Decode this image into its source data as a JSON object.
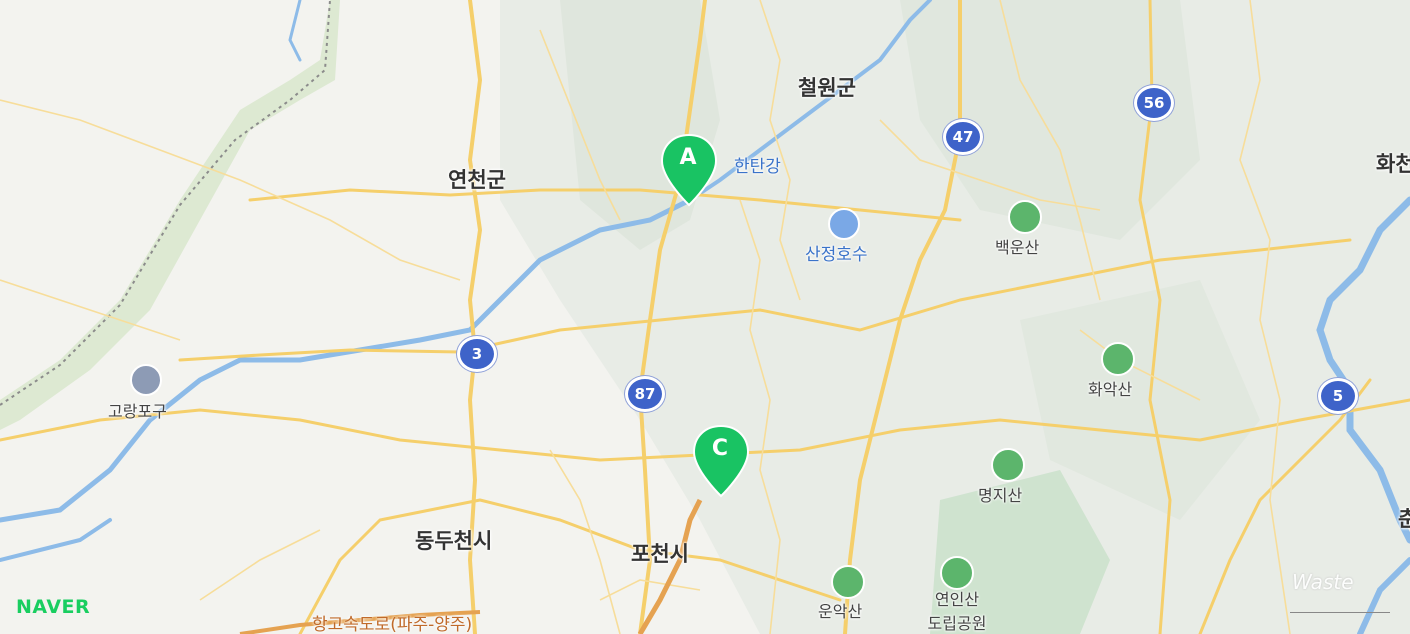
{
  "map": {
    "cities": [
      "철원군",
      "연천군",
      "동두천시",
      "포천시",
      "화천",
      "춘"
    ],
    "pois": [
      "한탄강",
      "산정호수",
      "고랑포구"
    ],
    "mountains": [
      "백운산",
      "화악산",
      "명지산",
      "운악산",
      "연인산\n도립공원"
    ],
    "route_shields": [
      "56",
      "47",
      "3",
      "87",
      "5"
    ],
    "markers": [
      "A",
      "C"
    ],
    "highway_label": "고속도로(파주-양주)",
    "highway_prefix": "항",
    "logo": "NAVER",
    "watermark": "Waste",
    "colors": {
      "marker": "#19c363",
      "shield": "#3e63c9",
      "mountain_icon": "#5cb56c",
      "river": "#7fb0e3",
      "road": "#f5cf6b"
    }
  }
}
